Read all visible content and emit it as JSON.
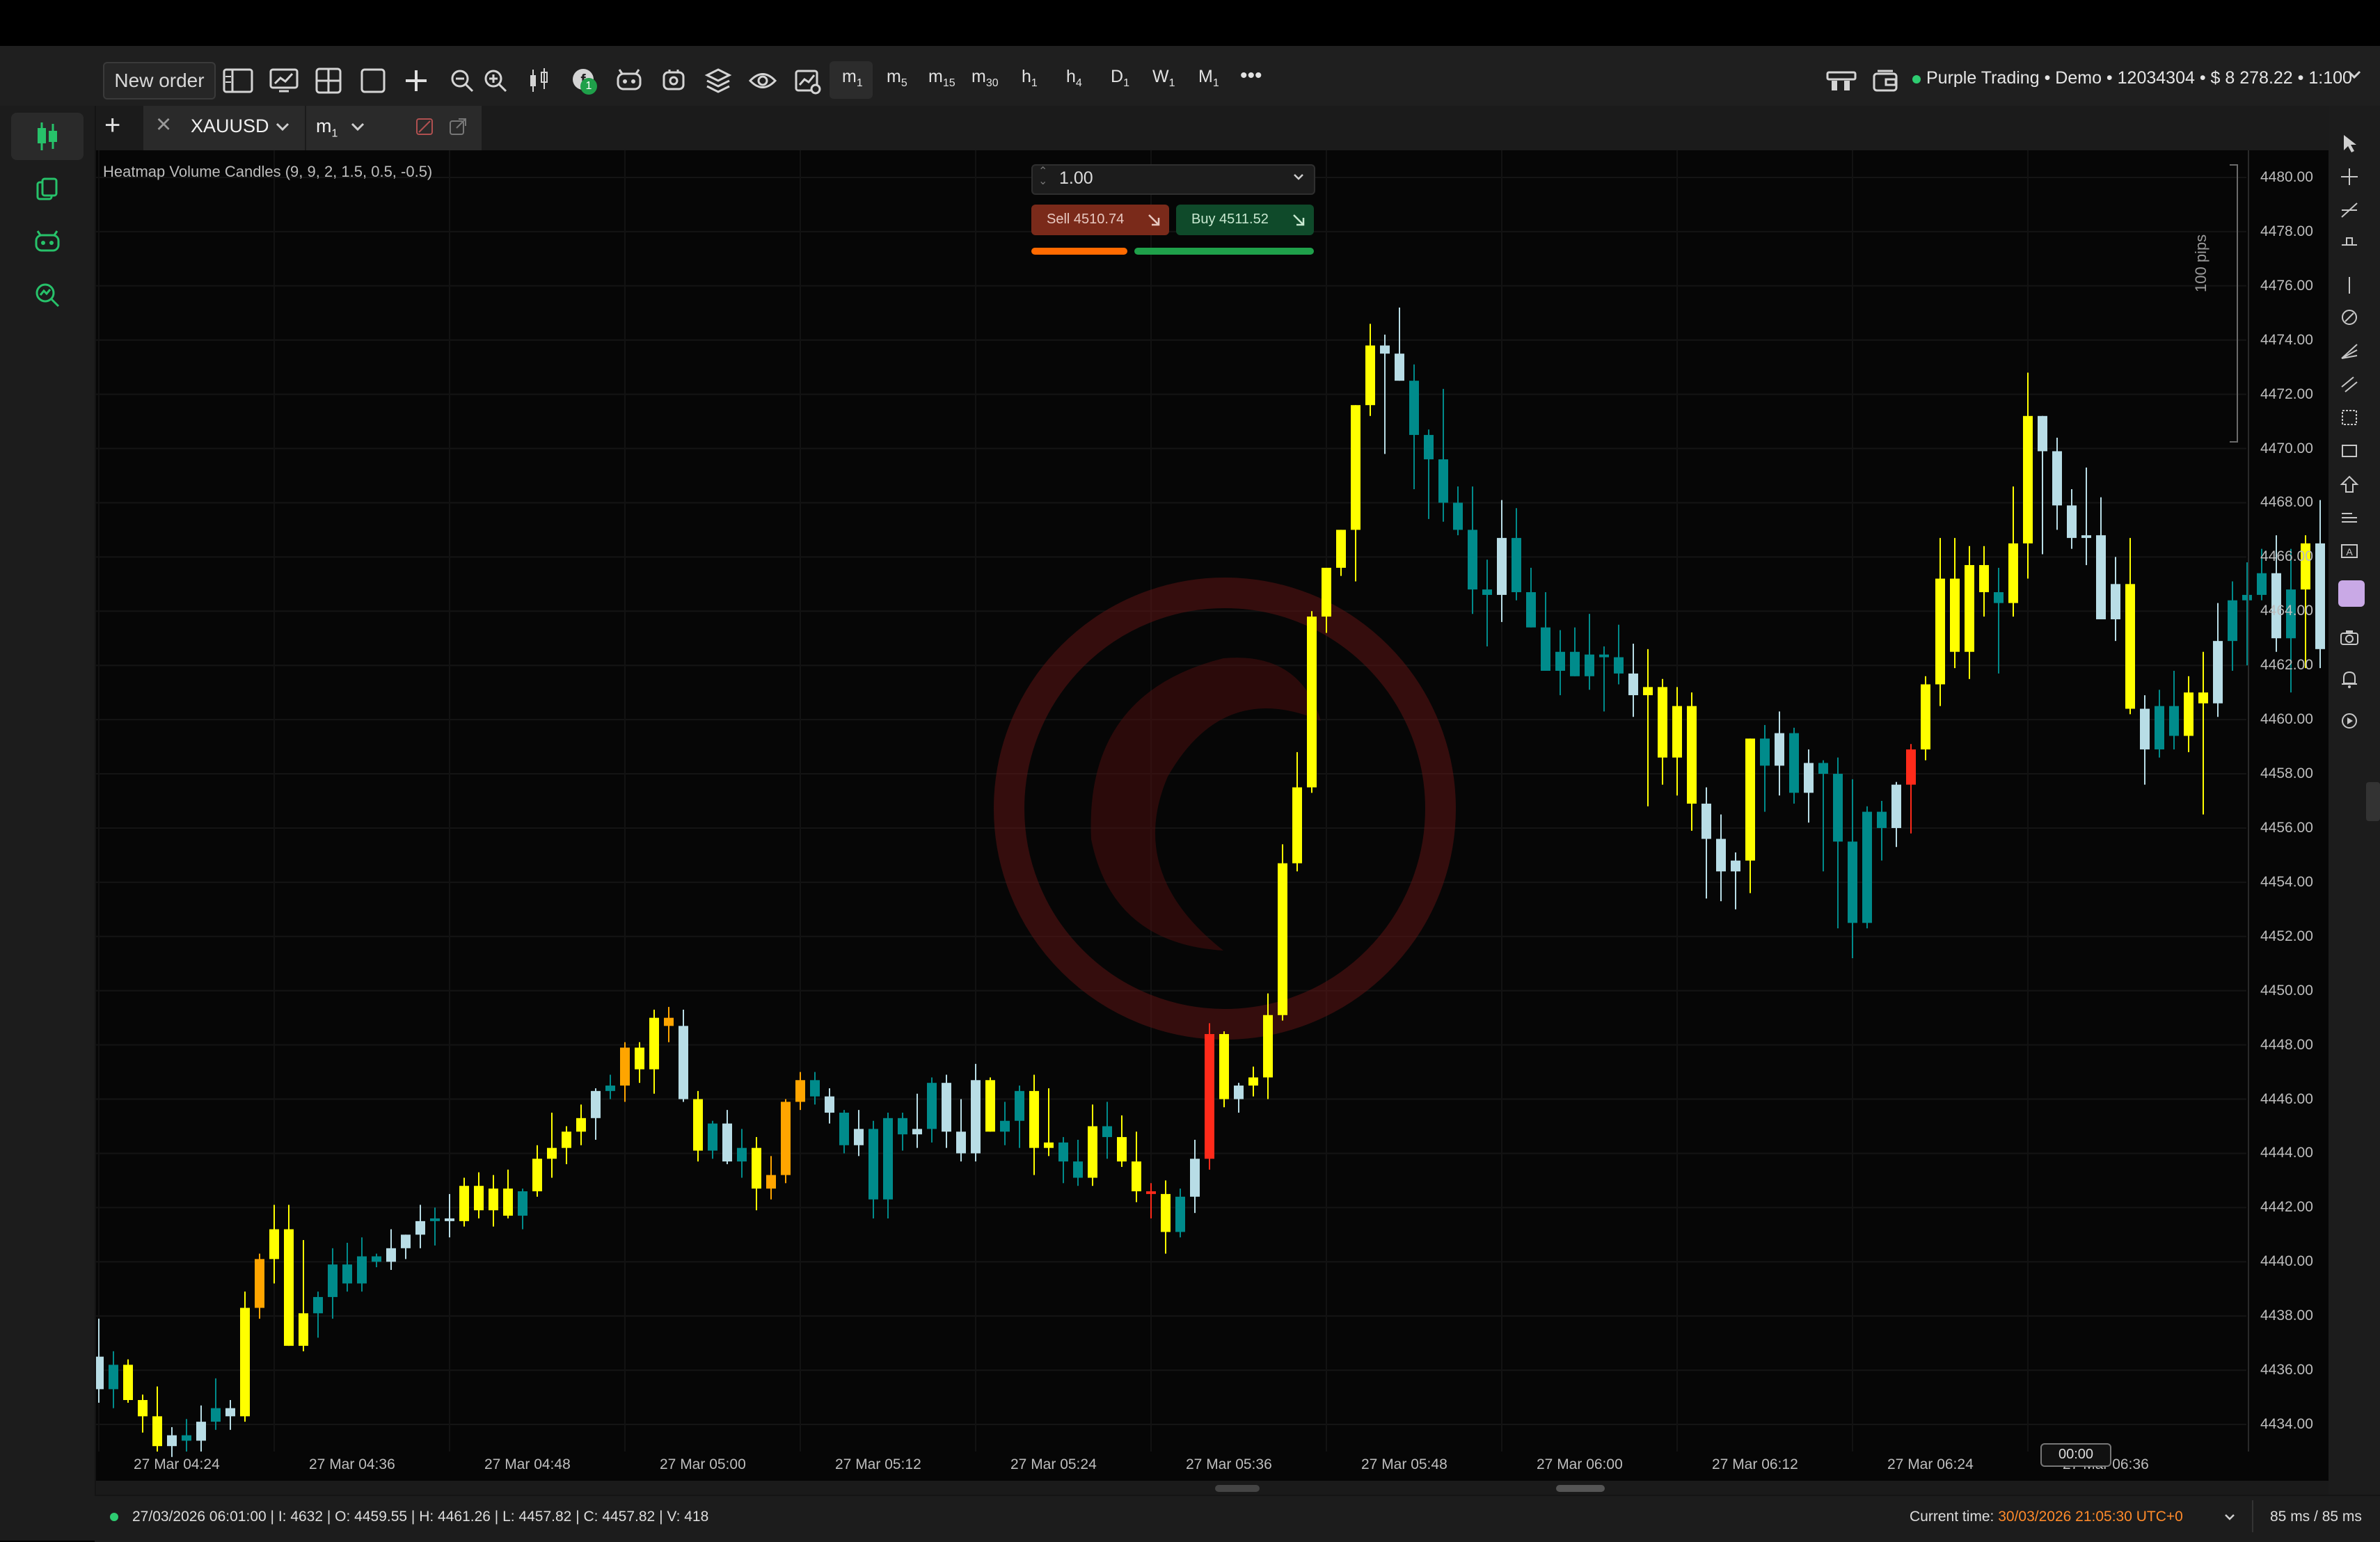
{
  "toolbar": {
    "new_order_label": "New order",
    "timeframes": [
      {
        "base": "m",
        "sub": "1"
      },
      {
        "base": "m",
        "sub": "5"
      },
      {
        "base": "m",
        "sub": "15"
      },
      {
        "base": "m",
        "sub": "30"
      },
      {
        "base": "h",
        "sub": "1"
      },
      {
        "base": "h",
        "sub": "4"
      },
      {
        "base": "D",
        "sub": "1"
      },
      {
        "base": "W",
        "sub": "1"
      },
      {
        "base": "M",
        "sub": "1"
      }
    ],
    "more_label": "•••",
    "alert_badge": "1",
    "account": {
      "broker": "Purple Trading",
      "type": "Demo",
      "number": "12034304",
      "balance": "$ 8 278.22",
      "leverage": "1:100",
      "separator": "•"
    }
  },
  "tab": {
    "add_label": "+",
    "close_label": "×",
    "symbol": "XAUUSD",
    "timeframe_base": "m",
    "timeframe_sub": "1"
  },
  "indicator_label": "Heatmap Volume Candles (9, 9, 2, 1.5, 0.5, -0.5)",
  "trade_panel": {
    "volume": "1.00",
    "sell_label": "Sell 4510.74",
    "buy_label": "Buy 4511.52"
  },
  "pips_label": "100 pips",
  "time_marker": "00:00",
  "status": {
    "datetime": "27/03/2026 06:01:00",
    "index": "I: 4632",
    "open": "O: 4459.55",
    "high": "H: 4461.26",
    "low": "L: 4457.82",
    "close": "C: 4457.82",
    "volume": "V: 418",
    "current_time_label": "Current time:",
    "current_time_value": "30/03/2026 21:05:30",
    "timezone": "UTC+0",
    "latency": "85 ms / 85 ms"
  },
  "colors": {
    "accent_green": "#2ecc71",
    "sell": "#7a2a1a",
    "buy": "#0f4a2a",
    "heat_extreme": "#ff2a1a",
    "heat_high": "#ffa500",
    "heat_mid": "#ffff00",
    "heat_normal": "#b8dde6",
    "heat_low": "#008b8b"
  },
  "chart_data": {
    "type": "candlestick",
    "symbol": "XAUUSD",
    "ylim": [
      4433,
      4481
    ],
    "y_ticks": [
      "4480.00",
      "4478.00",
      "4476.00",
      "4474.00",
      "4472.00",
      "4470.00",
      "4468.00",
      "4466.00",
      "4464.00",
      "4462.00",
      "4460.00",
      "4458.00",
      "4456.00",
      "4454.00",
      "4452.00",
      "4450.00",
      "4448.00",
      "4446.00",
      "4444.00",
      "4442.00",
      "4440.00",
      "4438.00",
      "4436.00",
      "4434.00"
    ],
    "x_ticks": [
      "27 Mar 04:24",
      "27 Mar 04:36",
      "27 Mar 04:48",
      "27 Mar 05:00",
      "27 Mar 05:12",
      "27 Mar 05:24",
      "27 Mar 05:36",
      "27 Mar 05:48",
      "27 Mar 06:00",
      "27 Mar 06:12",
      "27 Mar 06:24",
      "27 Mar 06:36"
    ],
    "first_candle_time": "04:24",
    "candle_minutes": 1,
    "heat_levels": [
      "extreme",
      "high",
      "mid",
      "normal",
      "low"
    ],
    "candles": [
      [
        4436.5,
        4437.9,
        4434.8,
        4435.3,
        "normal"
      ],
      [
        4435.3,
        4436.7,
        4434.6,
        4436.2,
        "low"
      ],
      [
        4436.2,
        4436.4,
        4434.8,
        4434.9,
        "mid"
      ],
      [
        4434.9,
        4435.1,
        4433.7,
        4434.3,
        "mid"
      ],
      [
        4434.3,
        4435.4,
        4433.0,
        4433.2,
        "mid"
      ],
      [
        4433.2,
        4433.9,
        4432.8,
        4433.6,
        "normal"
      ],
      [
        4433.6,
        4434.2,
        4433.0,
        4433.4,
        "low"
      ],
      [
        4433.4,
        4434.7,
        4433.0,
        4434.1,
        "normal"
      ],
      [
        4434.1,
        4435.7,
        4433.8,
        4434.6,
        "low"
      ],
      [
        4434.6,
        4434.9,
        4433.8,
        4434.3,
        "normal"
      ],
      [
        4434.3,
        4438.9,
        4434.1,
        4438.3,
        "mid"
      ],
      [
        4438.3,
        4440.3,
        4437.9,
        4440.1,
        "high"
      ],
      [
        4440.1,
        4442.1,
        4439.2,
        4441.2,
        "mid"
      ],
      [
        4441.2,
        4442.1,
        4436.9,
        4436.9,
        "mid"
      ],
      [
        4436.9,
        4440.8,
        4436.7,
        4438.1,
        "mid"
      ],
      [
        4438.1,
        4438.9,
        4437.2,
        4438.7,
        "low"
      ],
      [
        4438.7,
        4440.5,
        4437.9,
        4439.9,
        "low"
      ],
      [
        4439.9,
        4440.7,
        4438.9,
        4439.2,
        "low"
      ],
      [
        4439.2,
        4440.9,
        4438.9,
        4440.2,
        "low"
      ],
      [
        4440.2,
        4440.3,
        4439.8,
        4440.0,
        "low"
      ],
      [
        4440.0,
        4441.2,
        4439.7,
        4440.5,
        "normal"
      ],
      [
        4440.5,
        4441.0,
        4440.1,
        4441.0,
        "normal"
      ],
      [
        4441.0,
        4442.1,
        4440.5,
        4441.5,
        "normal"
      ],
      [
        4441.5,
        4442.0,
        4440.6,
        4441.6,
        "low"
      ],
      [
        4441.6,
        4442.5,
        4440.9,
        4441.5,
        "normal"
      ],
      [
        4441.5,
        4443.1,
        4441.3,
        4442.8,
        "mid"
      ],
      [
        4442.8,
        4443.3,
        4441.6,
        4441.9,
        "mid"
      ],
      [
        4441.9,
        4443.2,
        4441.3,
        4442.7,
        "mid"
      ],
      [
        4442.7,
        4443.4,
        4441.6,
        4441.7,
        "mid"
      ],
      [
        4441.7,
        4442.7,
        4441.2,
        4442.6,
        "low"
      ],
      [
        4442.6,
        4444.3,
        4442.4,
        4443.8,
        "mid"
      ],
      [
        4443.8,
        4445.5,
        4443.1,
        4444.2,
        "mid"
      ],
      [
        4444.2,
        4445.0,
        4443.6,
        4444.8,
        "mid"
      ],
      [
        4444.8,
        4445.8,
        4444.3,
        4445.3,
        "mid"
      ],
      [
        4445.3,
        4446.4,
        4444.5,
        4446.3,
        "normal"
      ],
      [
        4446.3,
        4446.9,
        4446.0,
        4446.5,
        "low"
      ],
      [
        4446.5,
        4448.1,
        4445.9,
        4447.9,
        "high"
      ],
      [
        4447.9,
        4448.1,
        4446.6,
        4447.1,
        "mid"
      ],
      [
        4447.1,
        4449.3,
        4446.2,
        4449.0,
        "mid"
      ],
      [
        4449.0,
        4449.4,
        4448.1,
        4448.7,
        "high"
      ],
      [
        4448.7,
        4449.3,
        4445.9,
        4446.0,
        "normal"
      ],
      [
        4446.0,
        4446.3,
        4443.7,
        4444.1,
        "mid"
      ],
      [
        4444.1,
        4445.2,
        4443.8,
        4445.1,
        "low"
      ],
      [
        4445.1,
        4445.6,
        4443.6,
        4443.7,
        "normal"
      ],
      [
        4443.7,
        4444.9,
        4443.1,
        4444.2,
        "low"
      ],
      [
        4444.2,
        4444.6,
        4441.9,
        4442.7,
        "mid"
      ],
      [
        4442.7,
        4443.9,
        4442.3,
        4443.2,
        "high"
      ],
      [
        4443.2,
        4446.0,
        4442.9,
        4445.9,
        "high"
      ],
      [
        4445.9,
        4447.0,
        4445.6,
        4446.7,
        "high"
      ],
      [
        4446.7,
        4447.0,
        4445.8,
        4446.1,
        "low"
      ],
      [
        4446.1,
        4446.4,
        4445.1,
        4445.5,
        "normal"
      ],
      [
        4445.5,
        4445.6,
        4444.0,
        4444.3,
        "low"
      ],
      [
        4444.3,
        4445.6,
        4443.9,
        4444.9,
        "normal"
      ],
      [
        4444.9,
        4445.2,
        4441.6,
        4442.3,
        "low"
      ],
      [
        4442.3,
        4445.5,
        4441.6,
        4445.3,
        "low"
      ],
      [
        4445.3,
        4445.5,
        4444.1,
        4444.7,
        "low"
      ],
      [
        4444.7,
        4446.2,
        4444.2,
        4444.9,
        "normal"
      ],
      [
        4444.9,
        4446.8,
        4444.4,
        4446.6,
        "low"
      ],
      [
        4446.6,
        4446.9,
        4444.2,
        4444.8,
        "normal"
      ],
      [
        4444.8,
        4446.0,
        4443.7,
        4444.0,
        "normal"
      ],
      [
        4444.0,
        4447.3,
        4443.7,
        4446.7,
        "normal"
      ],
      [
        4446.7,
        4446.8,
        4444.8,
        4444.8,
        "mid"
      ],
      [
        4444.8,
        4445.9,
        4444.3,
        4445.2,
        "low"
      ],
      [
        4445.2,
        4446.5,
        4444.2,
        4446.3,
        "low"
      ],
      [
        4446.3,
        4446.9,
        4443.2,
        4444.2,
        "mid"
      ],
      [
        4444.2,
        4446.4,
        4443.9,
        4444.4,
        "mid"
      ],
      [
        4444.4,
        4444.6,
        4442.9,
        4443.7,
        "low"
      ],
      [
        4443.7,
        4444.5,
        4442.8,
        4443.1,
        "low"
      ],
      [
        4443.1,
        4445.8,
        4442.8,
        4445.0,
        "mid"
      ],
      [
        4445.0,
        4445.9,
        4443.8,
        4444.6,
        "low"
      ],
      [
        4444.6,
        4445.4,
        4443.5,
        4443.7,
        "mid"
      ],
      [
        4443.7,
        4444.8,
        4442.2,
        4442.6,
        "mid"
      ],
      [
        4442.6,
        4442.9,
        4441.6,
        4442.5,
        "extreme"
      ],
      [
        4442.5,
        4443.0,
        4440.3,
        4441.1,
        "mid"
      ],
      [
        4441.1,
        4442.7,
        4440.9,
        4442.4,
        "low"
      ],
      [
        4442.4,
        4444.5,
        4441.8,
        4443.8,
        "normal"
      ],
      [
        4443.8,
        4448.8,
        4443.4,
        4448.4,
        "extreme"
      ],
      [
        4448.4,
        4448.5,
        4445.7,
        4446.0,
        "mid"
      ],
      [
        4446.0,
        4446.6,
        4445.5,
        4446.5,
        "normal"
      ],
      [
        4446.5,
        4447.2,
        4446.1,
        4446.8,
        "mid"
      ],
      [
        4446.8,
        4449.9,
        4446.0,
        4449.1,
        "mid"
      ],
      [
        4449.1,
        4455.4,
        4448.9,
        4454.7,
        "mid"
      ],
      [
        4454.7,
        4458.8,
        4454.4,
        4457.5,
        "mid"
      ],
      [
        4457.5,
        4464.0,
        4457.3,
        4463.8,
        "mid"
      ],
      [
        4463.8,
        4465.6,
        4463.2,
        4465.6,
        "mid"
      ],
      [
        4465.6,
        4466.7,
        4465.3,
        4467.0,
        "mid"
      ],
      [
        4467.0,
        4468.1,
        4465.1,
        4471.6,
        "mid"
      ],
      [
        4471.6,
        4474.6,
        4471.2,
        4473.8,
        "mid"
      ],
      [
        4473.8,
        4474.2,
        4469.8,
        4473.5,
        "normal"
      ],
      [
        4473.5,
        4475.2,
        4472.6,
        4472.5,
        "normal"
      ],
      [
        4472.5,
        4473.1,
        4468.5,
        4470.5,
        "low"
      ],
      [
        4470.5,
        4470.7,
        4467.4,
        4469.6,
        "low"
      ],
      [
        4469.6,
        4472.2,
        4467.3,
        4468.0,
        "low"
      ],
      [
        4468.0,
        4468.6,
        4466.8,
        4467.0,
        "low"
      ],
      [
        4467.0,
        4468.6,
        4463.9,
        4464.8,
        "low"
      ],
      [
        4464.8,
        4465.9,
        4462.7,
        4464.6,
        "low"
      ],
      [
        4464.6,
        4468.1,
        4463.6,
        4466.7,
        "normal"
      ],
      [
        4466.7,
        4467.8,
        4464.4,
        4464.7,
        "low"
      ],
      [
        4464.7,
        4465.6,
        4463.8,
        4463.4,
        "low"
      ],
      [
        4463.4,
        4464.7,
        4462.0,
        4461.8,
        "low"
      ],
      [
        4461.8,
        4463.3,
        4460.9,
        4462.5,
        "low"
      ],
      [
        4462.5,
        4463.4,
        4461.9,
        4461.6,
        "low"
      ],
      [
        4461.6,
        4463.9,
        4461.1,
        4462.4,
        "low"
      ],
      [
        4462.4,
        4462.7,
        4460.3,
        4462.3,
        "low"
      ],
      [
        4462.3,
        4463.5,
        4461.3,
        4461.7,
        "low"
      ],
      [
        4461.7,
        4462.8,
        4460.1,
        4460.9,
        "normal"
      ],
      [
        4460.9,
        4462.6,
        4456.8,
        4461.2,
        "mid"
      ],
      [
        4461.2,
        4461.5,
        4457.6,
        4458.6,
        "mid"
      ],
      [
        4458.6,
        4461.2,
        4457.2,
        4460.5,
        "mid"
      ],
      [
        4460.5,
        4461.0,
        4455.9,
        4456.9,
        "mid"
      ],
      [
        4456.9,
        4457.5,
        4453.4,
        4455.6,
        "normal"
      ],
      [
        4455.6,
        4456.5,
        4453.3,
        4454.4,
        "normal"
      ],
      [
        4454.4,
        4455.1,
        4453.0,
        4454.8,
        "normal"
      ],
      [
        4454.8,
        4458.6,
        4453.6,
        4459.3,
        "mid"
      ],
      [
        4459.3,
        4459.8,
        4456.6,
        4458.3,
        "low"
      ],
      [
        4458.3,
        4460.3,
        4457.2,
        4459.5,
        "normal"
      ],
      [
        4459.5,
        4459.7,
        4456.9,
        4457.3,
        "low"
      ],
      [
        4457.3,
        4458.9,
        4456.2,
        4458.4,
        "normal"
      ],
      [
        4458.4,
        4458.5,
        4454.4,
        4458.0,
        "low"
      ],
      [
        4458.0,
        4458.6,
        4452.3,
        4455.5,
        "low"
      ],
      [
        4455.5,
        4457.8,
        4451.2,
        4452.5,
        "low"
      ],
      [
        4452.5,
        4456.8,
        4452.3,
        4456.6,
        "low"
      ],
      [
        4456.6,
        4457.0,
        4454.8,
        4456.0,
        "low"
      ],
      [
        4456.0,
        4457.7,
        4455.3,
        4457.6,
        "normal"
      ],
      [
        4457.6,
        4459.1,
        4455.8,
        4458.9,
        "extreme"
      ],
      [
        4458.9,
        4461.6,
        4458.5,
        4461.3,
        "mid"
      ],
      [
        4461.3,
        4466.7,
        4460.5,
        4465.2,
        "mid"
      ],
      [
        4465.2,
        4466.7,
        4461.9,
        4462.5,
        "mid"
      ],
      [
        4462.5,
        4466.4,
        4461.5,
        4465.7,
        "mid"
      ],
      [
        4465.7,
        4466.4,
        4463.8,
        4464.7,
        "mid"
      ],
      [
        4464.7,
        4465.6,
        4461.7,
        4464.3,
        "low"
      ],
      [
        4464.3,
        4468.6,
        4463.8,
        4466.5,
        "mid"
      ],
      [
        4466.5,
        4472.8,
        4465.2,
        4471.2,
        "mid"
      ],
      [
        4471.2,
        4471.1,
        4466.1,
        4469.9,
        "normal"
      ],
      [
        4469.9,
        4470.4,
        4467.0,
        4467.9,
        "normal"
      ],
      [
        4467.9,
        4468.5,
        4466.3,
        4466.7,
        "normal"
      ],
      [
        4466.7,
        4469.3,
        4465.7,
        4466.8,
        "normal"
      ],
      [
        4466.8,
        4468.2,
        4464.0,
        4463.7,
        "normal"
      ],
      [
        4463.7,
        4466.0,
        4462.9,
        4465.0,
        "normal"
      ],
      [
        4465.0,
        4466.7,
        4460.2,
        4460.4,
        "mid"
      ],
      [
        4460.4,
        4460.9,
        4457.6,
        4458.9,
        "normal"
      ],
      [
        4458.9,
        4461.1,
        4458.6,
        4460.5,
        "low"
      ],
      [
        4460.5,
        4461.8,
        4458.9,
        4459.4,
        "low"
      ],
      [
        4459.4,
        4461.6,
        4458.8,
        4461.0,
        "mid"
      ],
      [
        4461.0,
        4462.5,
        4456.5,
        4460.6,
        "mid"
      ],
      [
        4460.6,
        4464.3,
        4460.1,
        4462.9,
        "normal"
      ],
      [
        4462.9,
        4465.1,
        4461.8,
        4464.4,
        "low"
      ],
      [
        4464.4,
        4465.8,
        4462.0,
        4464.6,
        "low"
      ],
      [
        4464.6,
        4466.3,
        4464.4,
        4465.4,
        "low"
      ],
      [
        4465.4,
        4466.8,
        4462.5,
        4463.0,
        "normal"
      ],
      [
        4463.0,
        4466.3,
        4461.0,
        4464.8,
        "low"
      ],
      [
        4464.8,
        4466.8,
        4461.9,
        4466.5,
        "mid"
      ],
      [
        4466.5,
        4468.1,
        4461.9,
        4462.6,
        "normal"
      ],
      [
        4462.6,
        4463.9,
        4460.6,
        4462.7,
        "normal"
      ],
      [
        4462.7,
        4464.0,
        4461.3,
        4463.0,
        "normal"
      ],
      [
        4463.0,
        4463.9,
        4461.9,
        4463.7,
        "low"
      ],
      [
        4463.7,
        4464.6,
        4462.9,
        4463.9,
        "low"
      ],
      [
        4463.9,
        4468.6,
        4462.9,
        4467.6,
        "low"
      ],
      [
        4467.6,
        4467.9,
        4464.9,
        4465.7,
        "low"
      ],
      [
        4465.7,
        4469.1,
        4462.6,
        4467.5,
        "low"
      ],
      [
        4467.5,
        4467.9,
        4462.6,
        4463.6,
        "low"
      ],
      [
        4463.6,
        4466.5,
        4463.1,
        4466.3,
        "normal"
      ],
      [
        4466.3,
        4466.6,
        4464.1,
        4465.9,
        "normal"
      ],
      [
        4465.9,
        4467.1,
        4465.3,
        4466.4,
        "low"
      ],
      [
        4466.4,
        4468.4,
        4465.4,
        4465.3,
        "normal"
      ],
      [
        4465.3,
        4466.9,
        4465.0,
        4466.6,
        "low"
      ],
      [
        4466.6,
        4467.5,
        4464.3,
        4464.4,
        "normal"
      ],
      [
        4464.4,
        4466.2,
        4464.1,
        4465.3,
        "low"
      ],
      [
        4465.3,
        4466.7,
        4460.0,
        4460.6,
        "mid"
      ],
      [
        4460.6,
        4462.4,
        4459.8,
        4461.6,
        "normal"
      ],
      [
        4461.6,
        4462.7,
        4460.1,
        4460.1,
        "high"
      ],
      [
        4460.1,
        4461.3,
        4457.8,
        4460.9,
        "mid"
      ]
    ]
  }
}
